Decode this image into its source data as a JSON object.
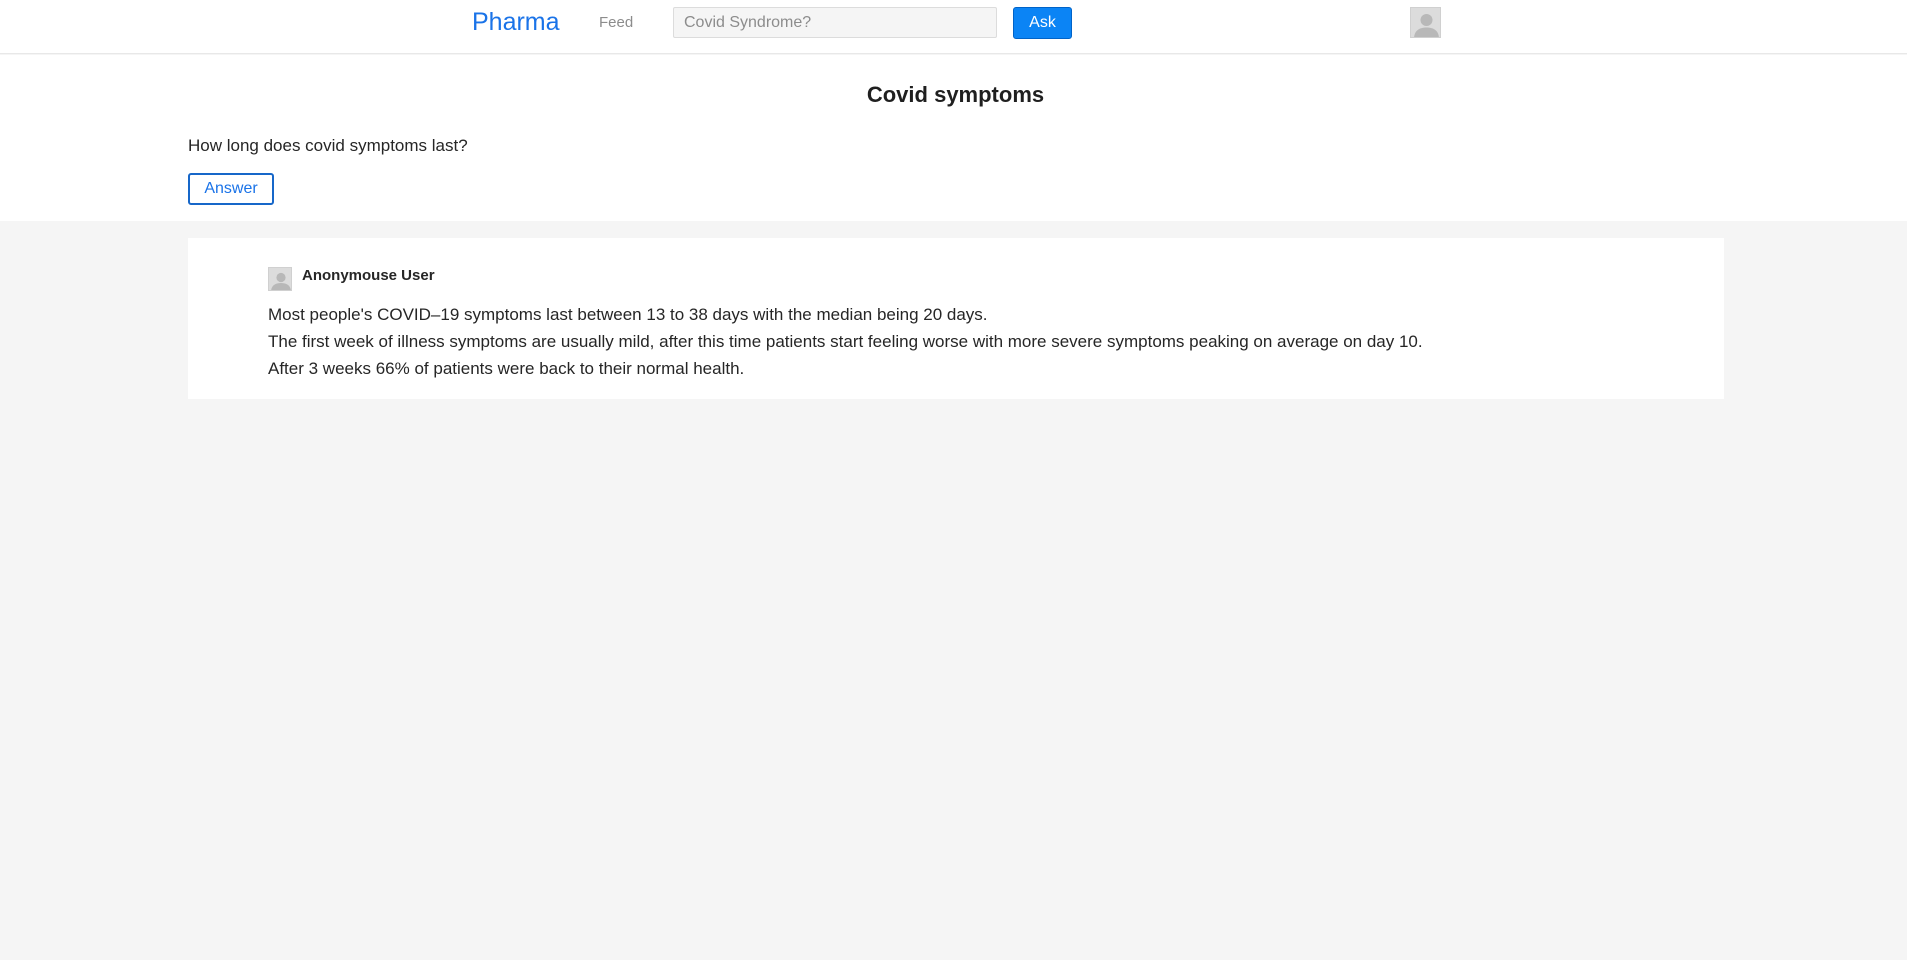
{
  "header": {
    "brand": "Pharma",
    "nav_feed": "Feed",
    "search": {
      "placeholder": "Covid Syndrome?",
      "value": ""
    },
    "ask_label": "Ask",
    "avatar_icon": "user-avatar-icon"
  },
  "question": {
    "title": "Covid symptoms",
    "body": "How long does covid symptoms last?",
    "answer_button": "Answer"
  },
  "answers": [
    {
      "author": "Anonymouse User",
      "avatar_icon": "user-avatar-icon",
      "lines": [
        "Most people's COVID–19 symptoms last between 13 to 38 days with the median being 20 days.",
        "The first week of illness symptoms are usually mild, after this time patients start feeling worse with more severe symptoms peaking on average on day 10.",
        "After 3 weeks 66% of patients were back to their normal health."
      ]
    }
  ],
  "colors": {
    "brand": "#1a73e8",
    "ask_button": "#0b84f5",
    "page_background": "#f5f5f5"
  }
}
